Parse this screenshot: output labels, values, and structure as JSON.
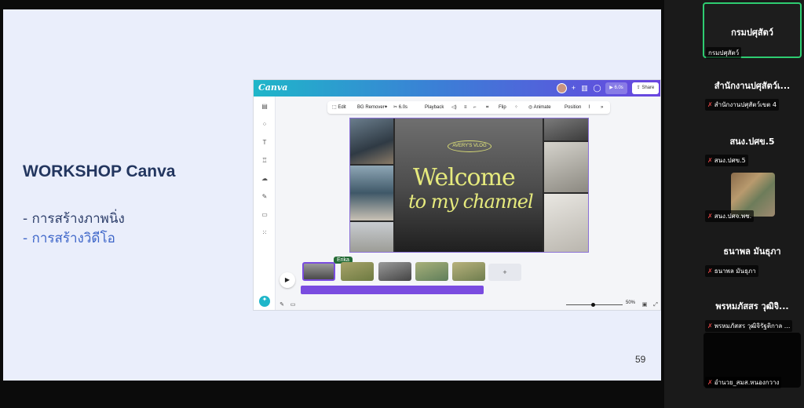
{
  "slide": {
    "title": "WORKSHOP Canva",
    "bullets": [
      "- การสร้างภาพนิ่ง",
      "- การสร้างวิดีโอ"
    ],
    "page_number": "59"
  },
  "canva": {
    "logo": "Canva",
    "edit_label": "Edit",
    "share_label": "Share",
    "toolbar": {
      "edit": "Edit",
      "bg_remover": "BG Remover",
      "duration": "6.0s",
      "playback": "Playback",
      "flip": "Flip",
      "animate": "Animate",
      "position": "Position"
    },
    "design": {
      "badge": "AVERY'S VLOG",
      "headline": "Welcome",
      "subheadline": "to my channel"
    },
    "collaborator_tag": "Erika",
    "add_clip": "+",
    "zoom": "50%"
  },
  "participants": [
    {
      "name": "กรมปศุสัตว์",
      "tag": "กรมปศุสัตว์",
      "active": true
    },
    {
      "name": "สำนักงานปศุสัตว์เ...",
      "tag": "สำนักงานปศุสัตว์เขต 4"
    },
    {
      "name": "สนง.ปศข.5",
      "tag": "สนง.ปศข.5"
    },
    {
      "name": "",
      "tag": "สนง.ปศจ.พช."
    },
    {
      "name": "ธนาพล มันธุภา",
      "tag": "ธนาพล มันธุภา"
    },
    {
      "name": "พรหมภัสสร วุฒิจิ...",
      "tag": "พรหมภัสสร วุฒิจิรัฐติกาล ..."
    },
    {
      "name": "",
      "tag": "อำนวย_สมส.หนองกวาง"
    }
  ],
  "colors": {
    "active_border": "#2ecc71",
    "mic_off": "#e24545",
    "title_color": "#23365f",
    "accent_blue": "#3e66c9"
  }
}
